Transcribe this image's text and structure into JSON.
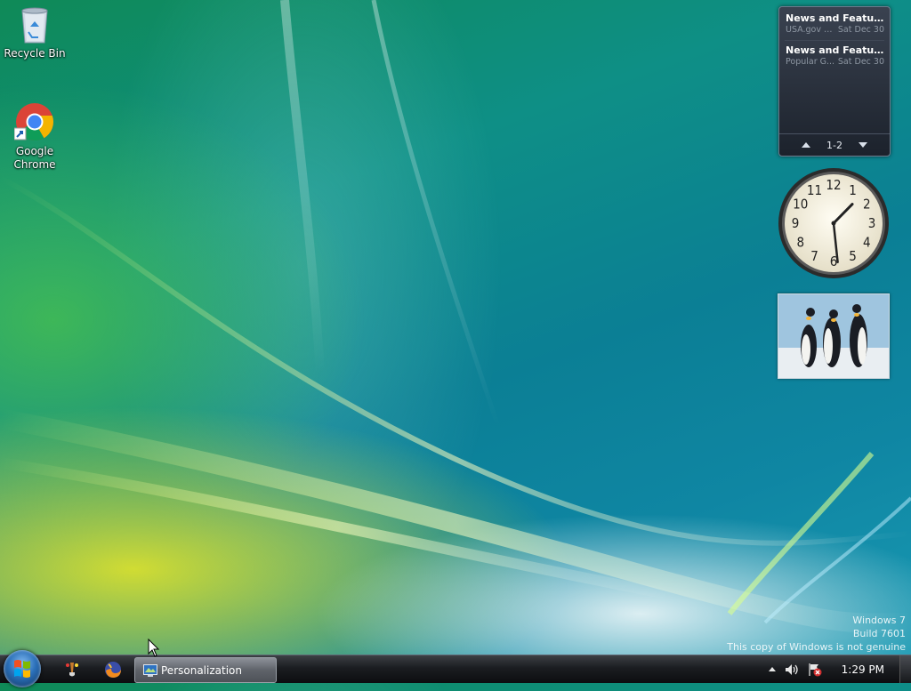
{
  "desktop": {
    "icons": [
      {
        "label": "Recycle Bin",
        "icon": "recycle-bin-icon"
      },
      {
        "label": "Google Chrome",
        "icon": "chrome-icon"
      }
    ],
    "watermark": {
      "line1": "Windows 7",
      "line2": "Build 7601",
      "line3": "This copy of Windows is not genuine"
    }
  },
  "gadgets": {
    "feed": {
      "items": [
        {
          "title": "News and Features f...",
          "source": "USA.gov U...",
          "date": "Sat Dec 30"
        },
        {
          "title": "News and Feature...",
          "source": "Popular G...",
          "date": "Sat Dec 30"
        }
      ],
      "page_indicator": "1-2"
    },
    "clock": {
      "time": "1:29",
      "numerals": [
        "12",
        "1",
        "2",
        "3",
        "4",
        "5",
        "6",
        "7",
        "8",
        "9",
        "10",
        "11"
      ]
    },
    "slideshow": {
      "subject": "penguins"
    }
  },
  "taskbar": {
    "start": "start-orb",
    "quick_launch": [
      "paint-icon",
      "firefox-icon"
    ],
    "active_task": {
      "label": "Personalization",
      "icon": "personalization-icon"
    },
    "tray": {
      "time": "1:29 PM",
      "icons": [
        "show-hidden-icons",
        "volume-icon",
        "action-center-icon"
      ]
    }
  },
  "colors": {
    "taskbar": "#1b1d21",
    "accent": "#2a6fb8"
  }
}
